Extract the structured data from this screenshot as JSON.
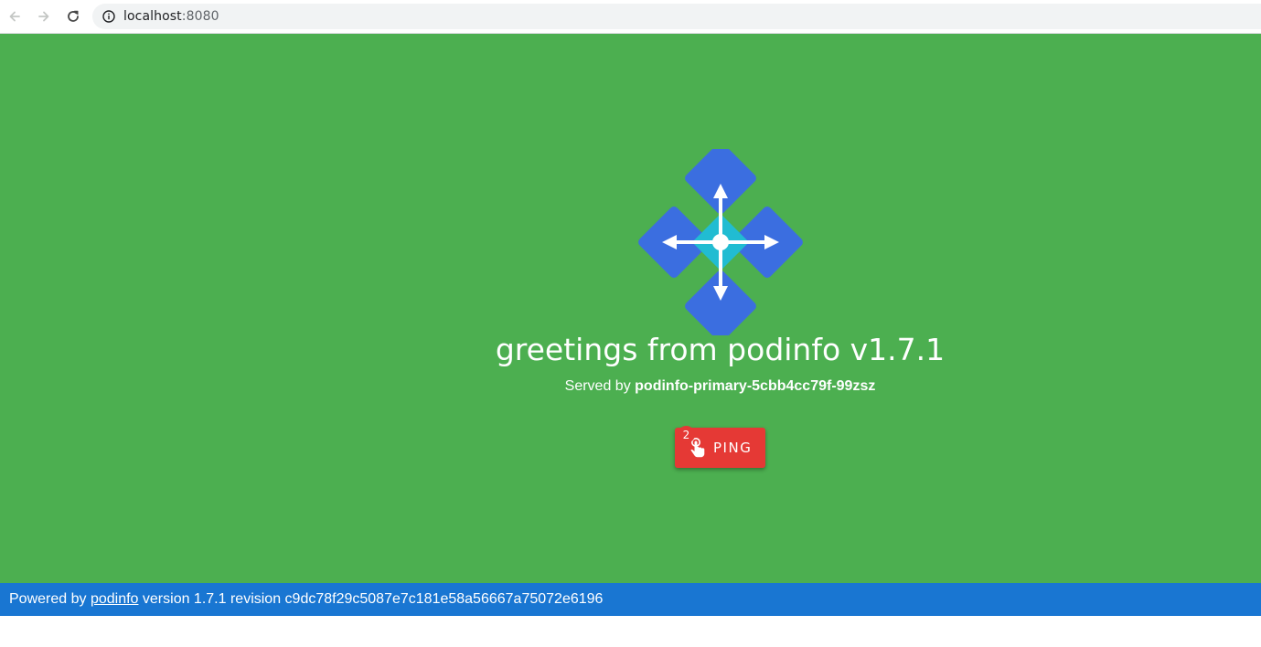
{
  "browser": {
    "url_host": "localhost",
    "url_port": ":8080",
    "icons": {
      "back": "arrow-left-icon",
      "forward": "arrow-right-icon",
      "reload": "reload-icon",
      "info": "info-icon"
    }
  },
  "main": {
    "background_color": "#4caf50",
    "logo": "podinfo-logo",
    "greeting": "greetings from podinfo v1.7.1",
    "served_by_prefix": "Served by",
    "pod_name": "podinfo-primary-5cbb4cc79f-99zsz",
    "ping": {
      "label": "PING",
      "badge_count": "2",
      "icon": "touch-app-icon",
      "color": "#e53935"
    }
  },
  "footer": {
    "background_color": "#1976d2",
    "prefix": "Powered by",
    "link_text": "podinfo",
    "suffix": "version 1.7.1 revision c9dc78f29c5087e7c181e58a56667a75072e6196"
  }
}
